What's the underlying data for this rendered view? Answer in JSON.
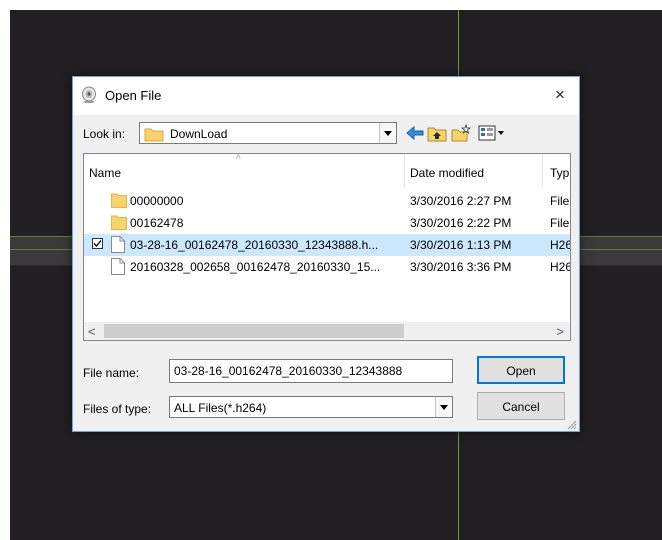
{
  "dialog": {
    "title": "Open File",
    "close_glyph": "×",
    "look_in_label": "Look in:",
    "look_in_value": "DownLoad",
    "toolbar": {
      "back_icon": "back-arrow-icon",
      "up_icon": "up-folder-icon",
      "new_folder_icon": "new-folder-icon",
      "view_icon": "view-menu-icon"
    }
  },
  "file_list": {
    "columns": {
      "name": "Name",
      "date": "Date modified",
      "type": "Typ"
    },
    "sort_indicator": "^",
    "rows": [
      {
        "kind": "folder",
        "name": "00000000",
        "date": "3/30/2016 2:27 PM",
        "type": "File",
        "selected": false
      },
      {
        "kind": "folder",
        "name": "00162478",
        "date": "3/30/2016 2:22 PM",
        "type": "File",
        "selected": false
      },
      {
        "kind": "file",
        "name": "03-28-16_00162478_20160330_12343888.h...",
        "date": "3/30/2016 1:13 PM",
        "type": "H26",
        "selected": true,
        "checked": "☑"
      },
      {
        "kind": "file",
        "name": "20160328_002658_00162478_20160330_15...",
        "date": "3/30/2016 3:36 PM",
        "type": "H26",
        "selected": false
      }
    ],
    "scroll_left": "<",
    "scroll_right": ">"
  },
  "form": {
    "file_name_label": "File name:",
    "file_name_value": "03-28-16_00162478_20160330_12343888",
    "files_of_type_label": "Files of type:",
    "files_of_type_value": "ALL Files(*.h264)",
    "open_label": "Open",
    "cancel_label": "Cancel"
  },
  "colors": {
    "background": "#221f22",
    "selection": "#cce8ff",
    "folder": "#f6d36b",
    "accent": "#0078d7",
    "guide_line": "#6c9a43"
  }
}
